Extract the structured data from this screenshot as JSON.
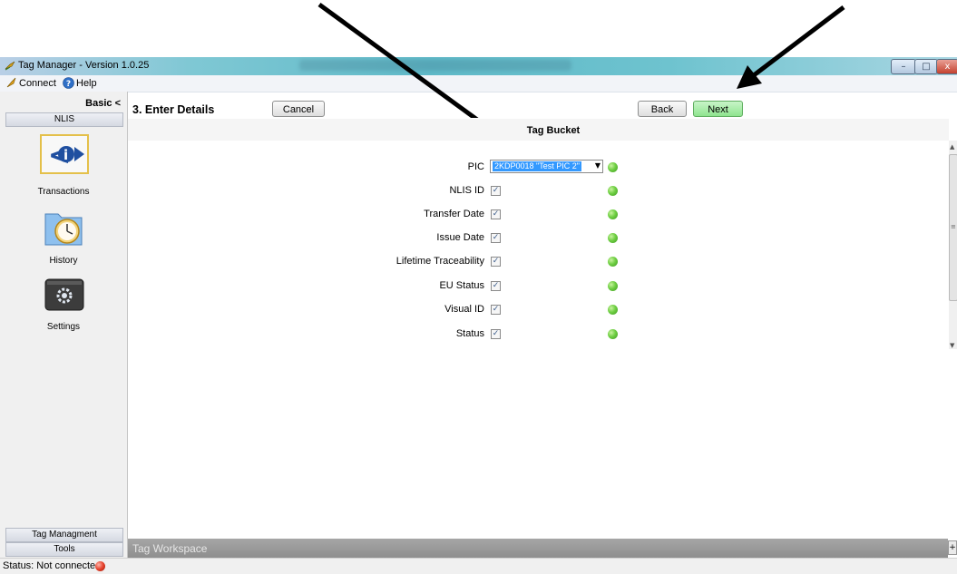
{
  "window": {
    "title": "Tag Manager - Version 1.0.25",
    "controls": {
      "minimize": "–",
      "maximize": "□",
      "close": "x"
    }
  },
  "menu": [
    {
      "label": "Connect",
      "icon": "connect-icon"
    },
    {
      "label": "Help",
      "icon": "help-icon"
    }
  ],
  "sidebar": {
    "mode_toggle": "Basic <",
    "section": "NLIS",
    "items": [
      {
        "label": "Transactions",
        "icon": "transactions-icon"
      },
      {
        "label": "History",
        "icon": "history-clock-icon"
      },
      {
        "label": "Settings",
        "icon": "settings-gear-icon"
      }
    ],
    "bottom_sections": [
      "Tag Managment",
      "Tools"
    ]
  },
  "wizard": {
    "step_title": "3. Enter Details",
    "buttons": {
      "cancel": "Cancel",
      "back": "Back",
      "next": "Next"
    }
  },
  "form": {
    "title": "Tag Bucket",
    "pic": {
      "label": "PIC",
      "value": "2KDP0018 \"Test PIC 2\""
    },
    "fields": [
      {
        "label": "NLIS ID",
        "checked": true
      },
      {
        "label": "Transfer Date",
        "checked": true
      },
      {
        "label": "Issue Date",
        "checked": true
      },
      {
        "label": "Lifetime Traceability",
        "checked": true
      },
      {
        "label": "EU Status",
        "checked": true
      },
      {
        "label": "Visual ID",
        "checked": true
      },
      {
        "label": "Status",
        "checked": true
      }
    ],
    "indicator_color": "#5ec23a"
  },
  "workspace": {
    "label": "Tag Workspace",
    "expand": "+"
  },
  "status": {
    "text": "Status: Not connected",
    "indicator_color": "#d9321e"
  },
  "colors": {
    "next_button": "#a6eba6",
    "annotation_arrow": "#000000"
  }
}
